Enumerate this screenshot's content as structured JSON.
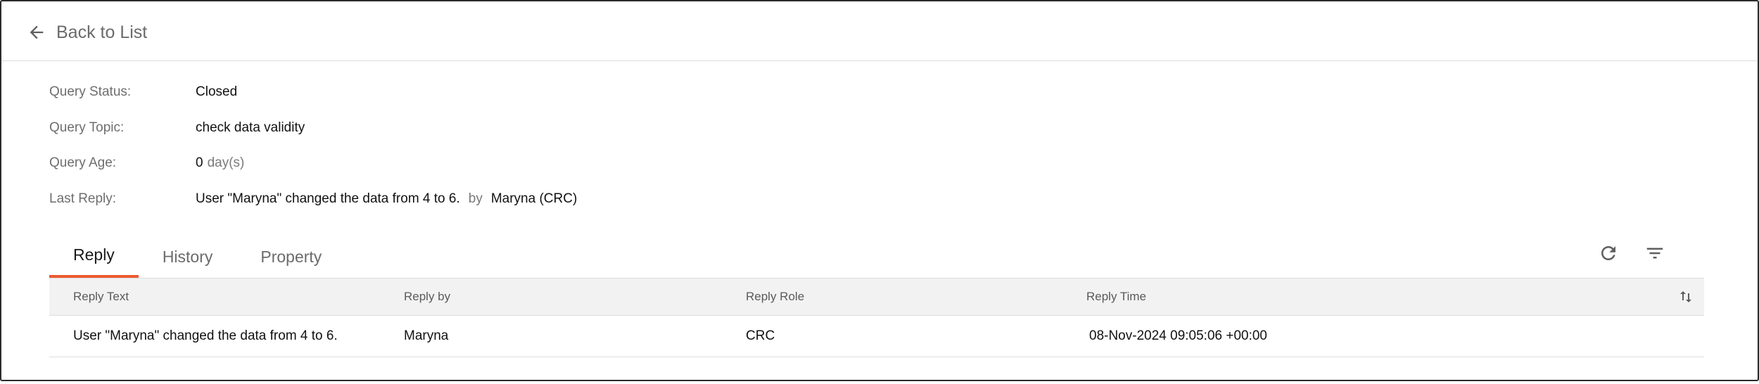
{
  "header": {
    "back_label": "Back to List"
  },
  "details": {
    "status_label": "Query Status:",
    "status_value": "Closed",
    "topic_label": "Query Topic:",
    "topic_value": "check data validity",
    "age_label": "Query Age:",
    "age_value": "0",
    "age_unit": "day(s)",
    "last_reply_label": "Last Reply:",
    "last_reply_text": "User \"Maryna\" changed the data from 4 to 6.",
    "last_reply_by_word": "by",
    "last_reply_author": "Maryna (CRC)"
  },
  "tabs": [
    {
      "label": "Reply",
      "active": true
    },
    {
      "label": "History",
      "active": false
    },
    {
      "label": "Property",
      "active": false
    }
  ],
  "table": {
    "columns": [
      "Reply Text",
      "Reply by",
      "Reply Role",
      "Reply Time"
    ],
    "rows": [
      {
        "text": "User \"Maryna\" changed the data from 4 to 6.",
        "by": "Maryna",
        "role": "CRC",
        "time": "08-Nov-2024 09:05:06 +00:00"
      }
    ]
  },
  "icons": {
    "back": "arrow-left-icon",
    "refresh": "refresh-icon",
    "filter": "filter-icon",
    "sort": "sort-icon"
  },
  "colors": {
    "accent": "#ec5a2e"
  }
}
